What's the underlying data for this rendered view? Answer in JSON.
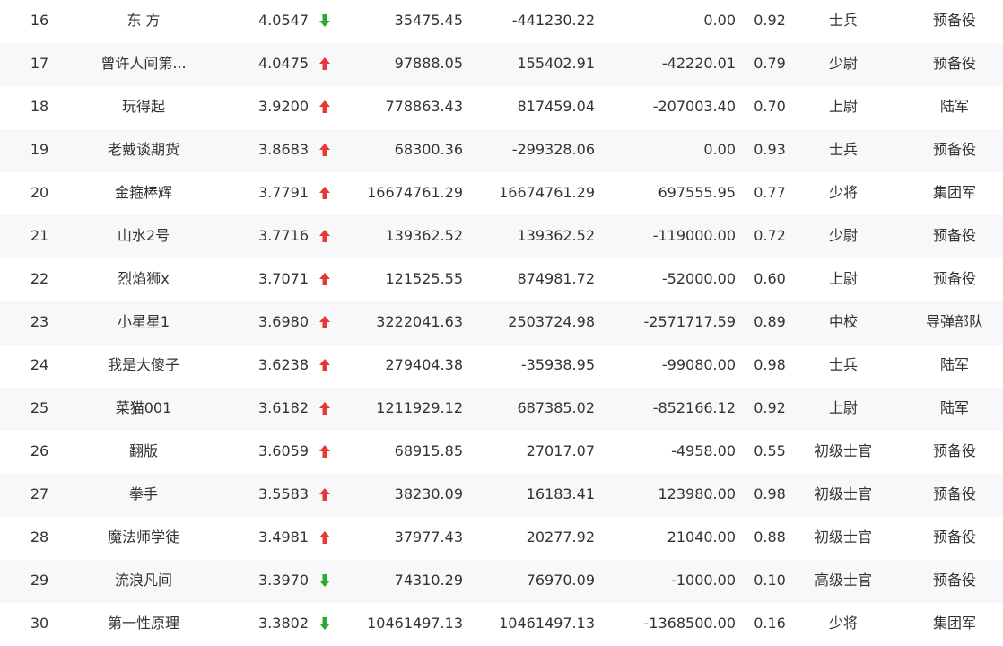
{
  "colors": {
    "up": "#e53935",
    "down": "#2eaa2e",
    "text": "#333333",
    "row_alt_bg": "#f7f8fa"
  },
  "rows": [
    {
      "rank": "16",
      "name": "东 方",
      "score": "4.0547",
      "trend": "down",
      "v1": "35475.45",
      "v2": "-441230.22",
      "v3": "0.00",
      "ratio": "0.92",
      "rank_name": "士兵",
      "unit": "预备役"
    },
    {
      "rank": "17",
      "name": "曾许人间第...",
      "score": "4.0475",
      "trend": "up",
      "v1": "97888.05",
      "v2": "155402.91",
      "v3": "-42220.01",
      "ratio": "0.79",
      "rank_name": "少尉",
      "unit": "预备役"
    },
    {
      "rank": "18",
      "name": "玩得起",
      "score": "3.9200",
      "trend": "up",
      "v1": "778863.43",
      "v2": "817459.04",
      "v3": "-207003.40",
      "ratio": "0.70",
      "rank_name": "上尉",
      "unit": "陆军"
    },
    {
      "rank": "19",
      "name": "老戴谈期货",
      "score": "3.8683",
      "trend": "up",
      "v1": "68300.36",
      "v2": "-299328.06",
      "v3": "0.00",
      "ratio": "0.93",
      "rank_name": "士兵",
      "unit": "预备役"
    },
    {
      "rank": "20",
      "name": "金箍棒辉",
      "score": "3.7791",
      "trend": "up",
      "v1": "16674761.29",
      "v2": "16674761.29",
      "v3": "697555.95",
      "ratio": "0.77",
      "rank_name": "少将",
      "unit": "集团军"
    },
    {
      "rank": "21",
      "name": "山水2号",
      "score": "3.7716",
      "trend": "up",
      "v1": "139362.52",
      "v2": "139362.52",
      "v3": "-119000.00",
      "ratio": "0.72",
      "rank_name": "少尉",
      "unit": "预备役"
    },
    {
      "rank": "22",
      "name": "烈焰狮x",
      "score": "3.7071",
      "trend": "up",
      "v1": "121525.55",
      "v2": "874981.72",
      "v3": "-52000.00",
      "ratio": "0.60",
      "rank_name": "上尉",
      "unit": "预备役"
    },
    {
      "rank": "23",
      "name": "小星星1",
      "score": "3.6980",
      "trend": "up",
      "v1": "3222041.63",
      "v2": "2503724.98",
      "v3": "-2571717.59",
      "ratio": "0.89",
      "rank_name": "中校",
      "unit": "导弹部队"
    },
    {
      "rank": "24",
      "name": "我是大傻子",
      "score": "3.6238",
      "trend": "up",
      "v1": "279404.38",
      "v2": "-35938.95",
      "v3": "-99080.00",
      "ratio": "0.98",
      "rank_name": "士兵",
      "unit": "陆军"
    },
    {
      "rank": "25",
      "name": "菜猫001",
      "score": "3.6182",
      "trend": "up",
      "v1": "1211929.12",
      "v2": "687385.02",
      "v3": "-852166.12",
      "ratio": "0.92",
      "rank_name": "上尉",
      "unit": "陆军"
    },
    {
      "rank": "26",
      "name": "翻版",
      "score": "3.6059",
      "trend": "up",
      "v1": "68915.85",
      "v2": "27017.07",
      "v3": "-4958.00",
      "ratio": "0.55",
      "rank_name": "初级士官",
      "unit": "预备役"
    },
    {
      "rank": "27",
      "name": "拳手",
      "score": "3.5583",
      "trend": "up",
      "v1": "38230.09",
      "v2": "16183.41",
      "v3": "123980.00",
      "ratio": "0.98",
      "rank_name": "初级士官",
      "unit": "预备役"
    },
    {
      "rank": "28",
      "name": "魔法师学徒",
      "score": "3.4981",
      "trend": "up",
      "v1": "37977.43",
      "v2": "20277.92",
      "v3": "21040.00",
      "ratio": "0.88",
      "rank_name": "初级士官",
      "unit": "预备役"
    },
    {
      "rank": "29",
      "name": "流浪凡间",
      "score": "3.3970",
      "trend": "down",
      "v1": "74310.29",
      "v2": "76970.09",
      "v3": "-1000.00",
      "ratio": "0.10",
      "rank_name": "高级士官",
      "unit": "预备役"
    },
    {
      "rank": "30",
      "name": "第一性原理",
      "score": "3.3802",
      "trend": "down",
      "v1": "10461497.13",
      "v2": "10461497.13",
      "v3": "-1368500.00",
      "ratio": "0.16",
      "rank_name": "少将",
      "unit": "集团军"
    }
  ]
}
